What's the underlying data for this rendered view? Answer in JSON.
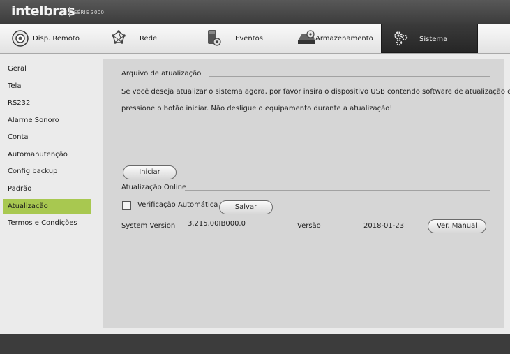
{
  "header": {
    "brand": "intelbras",
    "series": "SÉRIE 3000"
  },
  "tabs": [
    {
      "label": "Disp. Remoto",
      "icon": "camera-icon"
    },
    {
      "label": "Rede",
      "icon": "network-icon"
    },
    {
      "label": "Eventos",
      "icon": "events-icon"
    },
    {
      "label": "Armazenamento",
      "icon": "storage-icon"
    },
    {
      "label": "Sistema",
      "icon": "gears-icon",
      "active": true
    }
  ],
  "sidebar": {
    "items": [
      {
        "label": "Geral"
      },
      {
        "label": "Tela"
      },
      {
        "label": "RS232"
      },
      {
        "label": "Alarme Sonoro"
      },
      {
        "label": "Conta"
      },
      {
        "label": "Automanutenção"
      },
      {
        "label": "Config backup"
      },
      {
        "label": "Padrão"
      },
      {
        "label": "Atualização",
        "active": true
      },
      {
        "label": "Termos e Condições"
      }
    ]
  },
  "update": {
    "title": "Arquivo de atualização",
    "line1": "Se você deseja atualizar o sistema agora, por favor insira o dispositivo USB contendo software de atualização e",
    "line2": "pressione o botão iniciar. Não desligue o equipamento durante a atualização!",
    "start_button": "Iniciar"
  },
  "online": {
    "title": "Atualização Online",
    "auto_check_label": "Verificação Automática",
    "auto_check_checked": false,
    "save_button": "Salvar",
    "system_version_label": "System Version",
    "system_version_value": "3.215.00IB000.0",
    "version_label": "Versão",
    "version_date": "2018-01-23",
    "manual_button": "Ver. Manual"
  },
  "colors": {
    "accent_active": "#a8c850",
    "tab_active": "#2e2e2e"
  }
}
